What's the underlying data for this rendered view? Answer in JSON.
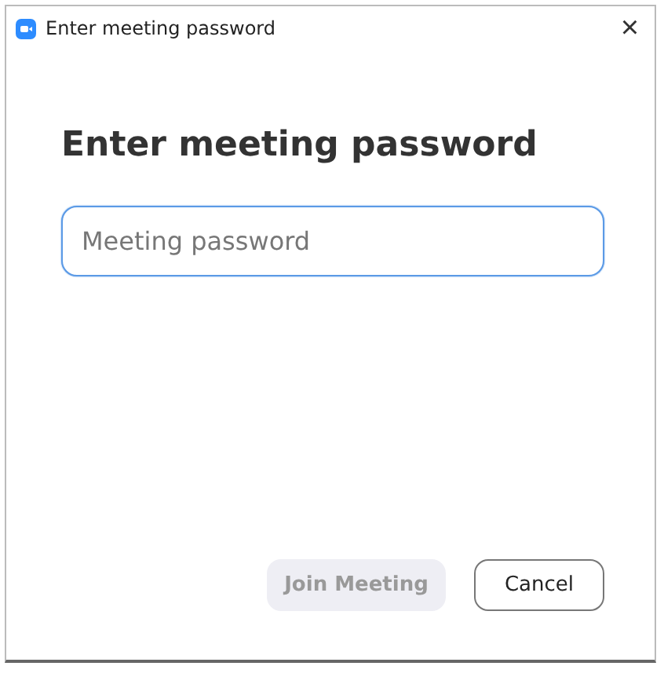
{
  "window": {
    "title": "Enter meeting password",
    "close": "×"
  },
  "heading": "Enter meeting password",
  "password_field": {
    "placeholder": "Meeting password",
    "focused": true
  },
  "buttons": [
    {
      "label": "Join Meeting",
      "kind": "primary",
      "disabled": true
    },
    {
      "label": "Cancel",
      "kind": "secondary",
      "disabled": false
    }
  ]
}
